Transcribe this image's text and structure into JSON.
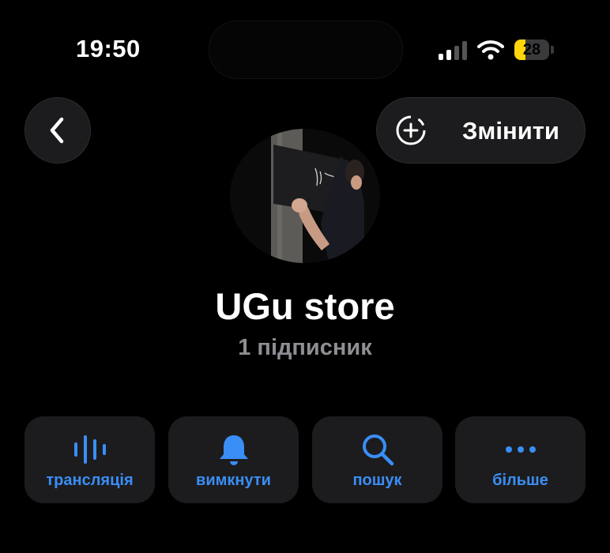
{
  "status_bar": {
    "time": "19:50",
    "battery_level": "28",
    "battery_color": "#ffd60a"
  },
  "header": {
    "back_icon": "chevron-left-icon",
    "edit_icon": "add-circle-icon",
    "edit_label": "Змінити"
  },
  "profile": {
    "avatar_icon": "channel-avatar-photo",
    "name": "UGu store",
    "subscribers": "1 підписник"
  },
  "actions": [
    {
      "icon": "waveform-icon",
      "label": "трансляція"
    },
    {
      "icon": "bell-icon",
      "label": "вимкнути"
    },
    {
      "icon": "search-icon",
      "label": "пошук"
    },
    {
      "icon": "more-icon",
      "label": "більше"
    }
  ],
  "colors": {
    "accent": "#3a8ef6",
    "background": "#000000",
    "button_bg": "#1c1c1e",
    "secondary_text": "#8e8e93"
  }
}
